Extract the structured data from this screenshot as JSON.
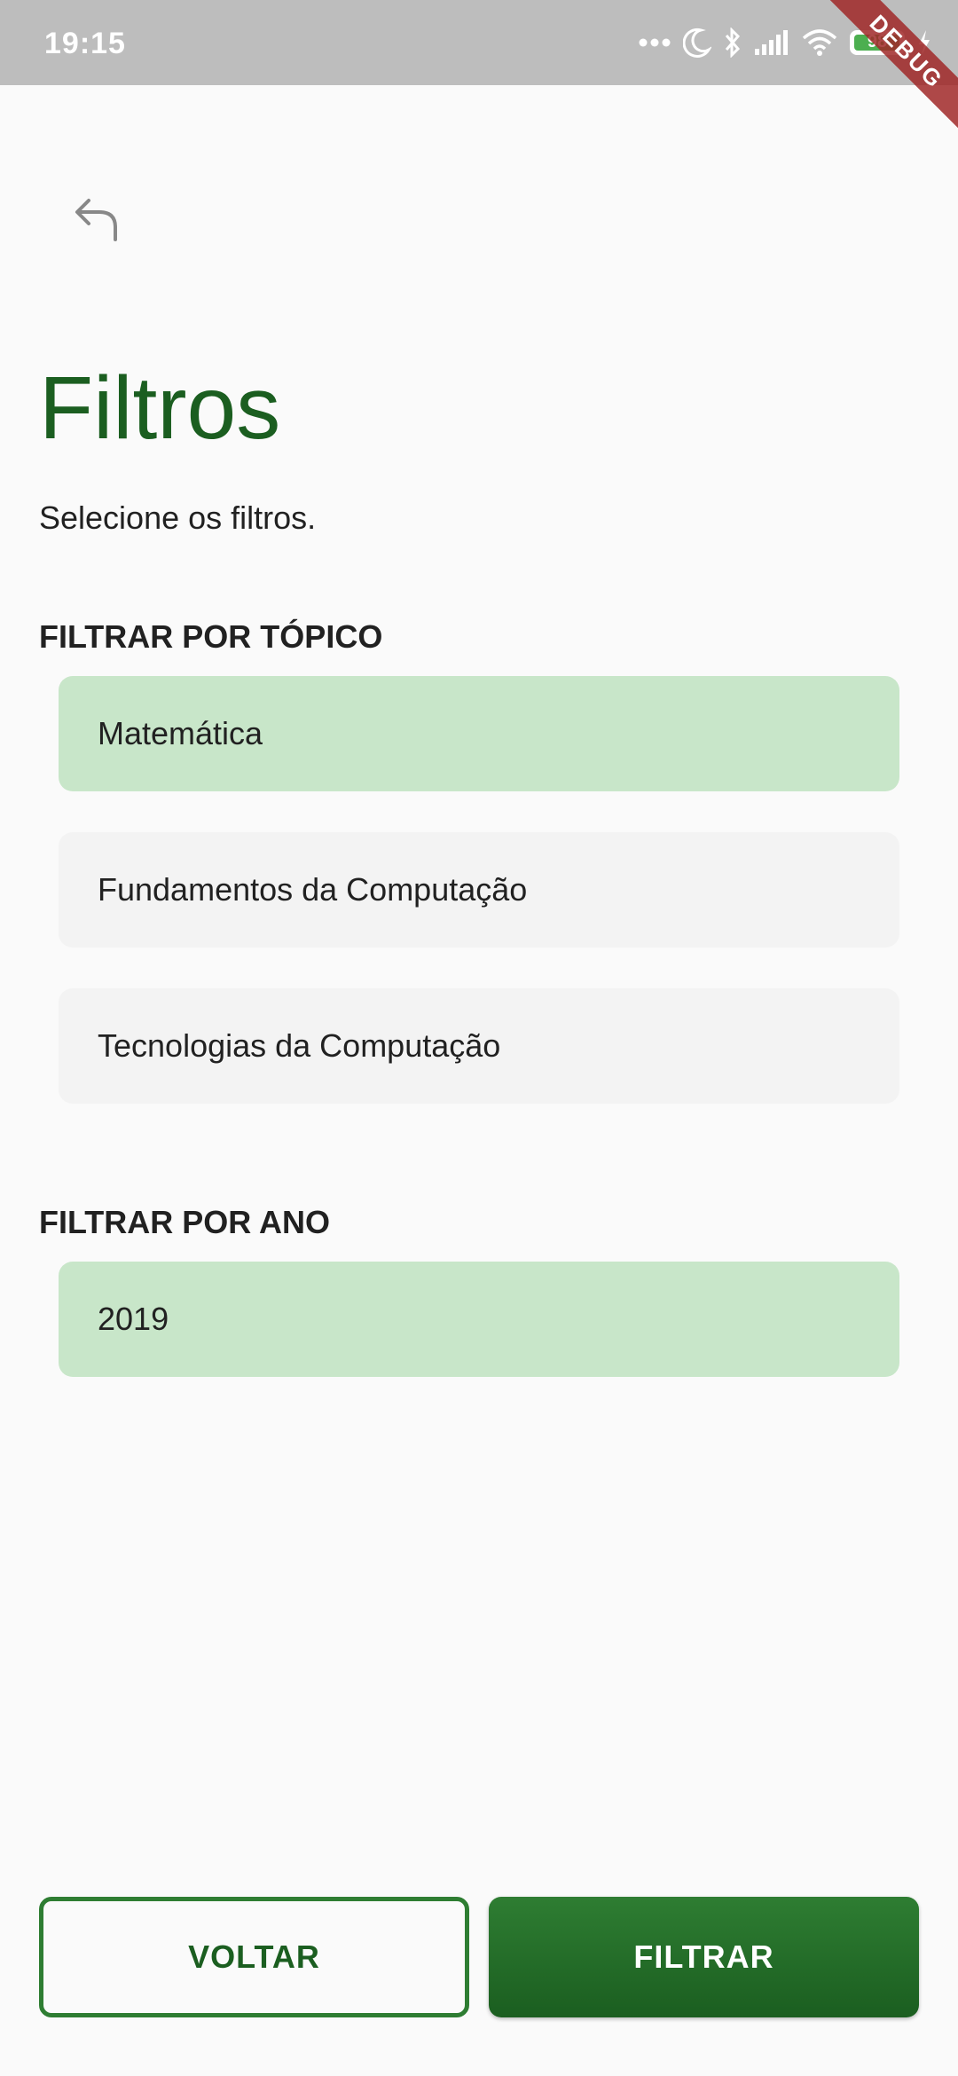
{
  "status_bar": {
    "time": "19:15",
    "battery_level": "98",
    "battery_fraction": 0.98,
    "icons": [
      "more-dots-icon",
      "moon-icon",
      "bluetooth-icon",
      "signal-icon",
      "wifi-icon",
      "battery-icon",
      "charging-bolt-icon"
    ]
  },
  "debug_banner": {
    "label": "DEBUG"
  },
  "header": {
    "back_icon": "back-arrow-icon",
    "title": "Filtros",
    "subtitle": "Selecione os filtros."
  },
  "topic_filter": {
    "heading": "FILTRAR POR TÓPICO",
    "options": [
      {
        "label": "Matemática",
        "selected": true
      },
      {
        "label": "Fundamentos da Computação",
        "selected": false
      },
      {
        "label": "Tecnologias da Computação",
        "selected": false
      }
    ]
  },
  "year_filter": {
    "heading": "FILTRAR POR ANO",
    "options": [
      {
        "label": "2019",
        "selected": true
      }
    ]
  },
  "actions": {
    "back_label": "VOLTAR",
    "filter_label": "FILTRAR"
  },
  "colors": {
    "accent": "#1b5e20",
    "selected_bg": "#c8e6c9",
    "unselected_bg": "#f3f3f3",
    "background": "#fafafa",
    "status_bar": "#bdbdbd"
  }
}
